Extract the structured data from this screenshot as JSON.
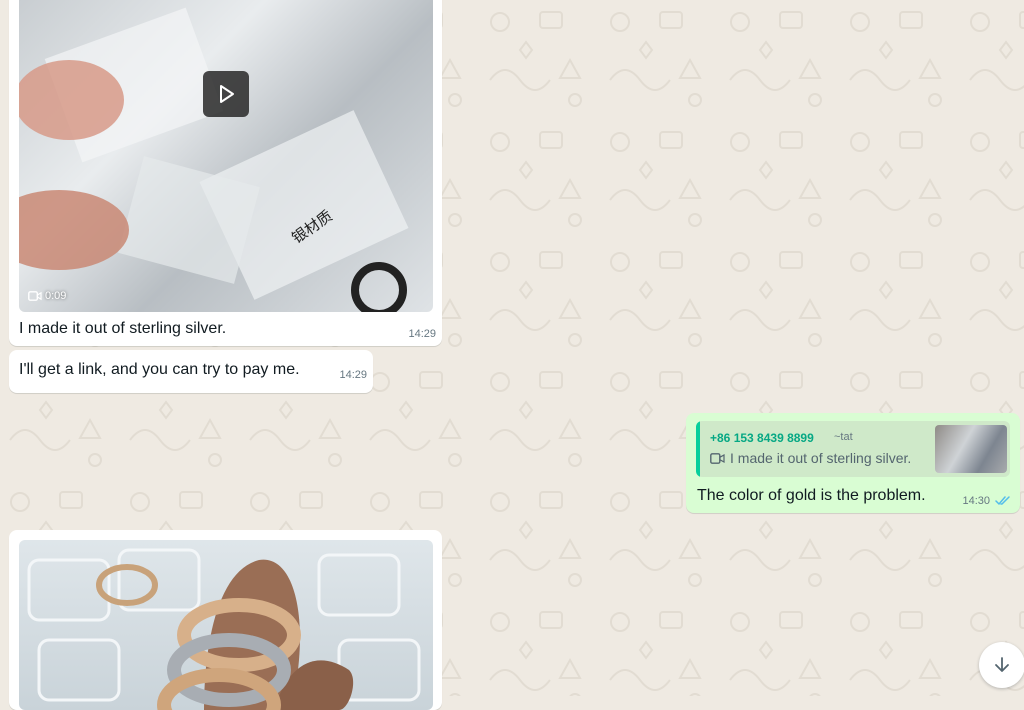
{
  "chat": {
    "messages": [
      {
        "direction": "incoming",
        "type": "video",
        "duration": "0:09",
        "caption": "I made it out of sterling silver.",
        "time": "14:29"
      },
      {
        "direction": "incoming",
        "type": "text",
        "text": "I'll get a link, and you can try to pay me.",
        "time": "14:29"
      },
      {
        "direction": "outgoing",
        "type": "reply",
        "quoted": {
          "sender": "+86 153 8439 8899",
          "alias": "~tat",
          "text": "I made it out of sterling silver.",
          "icon": "video-camera-icon"
        },
        "text": "The color of gold is the problem.",
        "time": "14:30",
        "status": "read"
      },
      {
        "direction": "incoming",
        "type": "image",
        "alt_icon": "ring-photo"
      }
    ]
  },
  "colors": {
    "background": "#efeae2",
    "incoming_bubble": "#ffffff",
    "outgoing_bubble": "#d9fdd3",
    "quote_accent": "#06cf9c",
    "read_ticks": "#53bdeb"
  },
  "icons": {
    "play": "play-icon",
    "video": "video-camera-icon",
    "read": "double-check-icon",
    "scroll": "arrow-down-icon"
  }
}
